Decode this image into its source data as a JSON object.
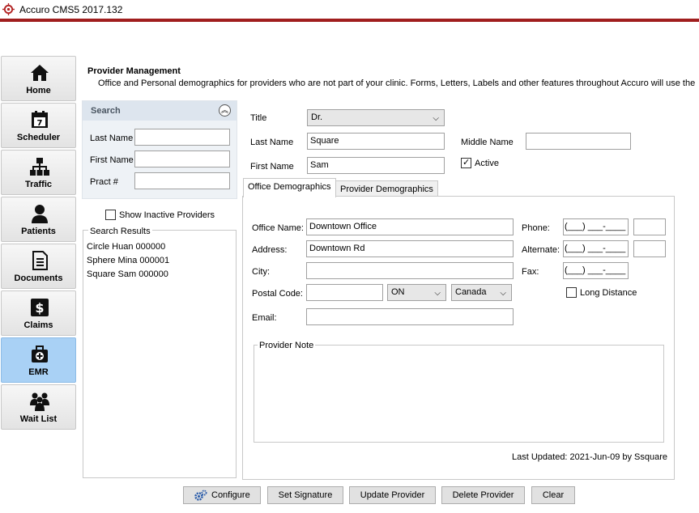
{
  "window": {
    "title": "Accuro CMS5 2017.132"
  },
  "sidebar": {
    "items": [
      {
        "label": "Home",
        "icon": "home-icon"
      },
      {
        "label": "Scheduler",
        "icon": "calendar-icon"
      },
      {
        "label": "Traffic",
        "icon": "org-chart-icon"
      },
      {
        "label": "Patients",
        "icon": "person-icon"
      },
      {
        "label": "Documents",
        "icon": "document-icon"
      },
      {
        "label": "Claims",
        "icon": "dollar-icon"
      },
      {
        "label": "EMR",
        "icon": "medical-bag-icon"
      },
      {
        "label": "Wait List",
        "icon": "group-icon"
      }
    ],
    "active": "EMR"
  },
  "header": {
    "title": "Provider Management",
    "subtitle": "Office and Personal demographics for providers who are not part of your clinic. Forms, Letters, Labels and other features throughout Accuro will use the"
  },
  "search": {
    "title": "Search",
    "last_name_label": "Last Name",
    "first_name_label": "First Name",
    "pract_label": "Pract #",
    "last_name_value": "",
    "first_name_value": "",
    "pract_value": "",
    "show_inactive_label": "Show Inactive Providers",
    "show_inactive_checked": false,
    "results_title": "Search Results",
    "results": [
      "Circle  Huan  000000",
      "Sphere  Mina  000001",
      "Square  Sam  000000"
    ]
  },
  "provider": {
    "title_label": "Title",
    "title_value": "Dr.",
    "last_name_label": "Last Name",
    "last_name_value": "Square",
    "middle_name_label": "Middle Name",
    "middle_name_value": "",
    "first_name_label": "First Name",
    "first_name_value": "Sam",
    "active_label": "Active",
    "active_checked": true
  },
  "tabs": [
    {
      "label": "Office Demographics",
      "selected": true
    },
    {
      "label": "Provider Demographics",
      "selected": false
    }
  ],
  "office": {
    "office_name_label": "Office Name:",
    "office_name_value": "Downtown Office",
    "address_label": "Address:",
    "address_value": "Downtown Rd",
    "city_label": "City:",
    "city_value": "",
    "postal_label": "Postal Code:",
    "postal_value": "",
    "province_value": "ON",
    "country_value": "Canada",
    "email_label": "Email:",
    "email_value": "",
    "phone_label": "Phone:",
    "phone_value": "(___) ___-____",
    "alternate_label": "Alternate:",
    "alternate_value": "(___) ___-____",
    "fax_label": "Fax:",
    "fax_value": "(___) ___-____",
    "long_distance_label": "Long Distance",
    "long_distance_checked": false,
    "note_label": "Provider Note",
    "last_updated": "Last Updated: 2021-Jun-09 by Ssquare"
  },
  "buttons": {
    "configure": "Configure",
    "set_signature": "Set Signature",
    "update_provider": "Update Provider",
    "delete_provider": "Delete Provider",
    "clear": "Clear"
  },
  "colors": {
    "accent_bar": "#a01e1e",
    "active_nav": "#a9d1f5"
  }
}
